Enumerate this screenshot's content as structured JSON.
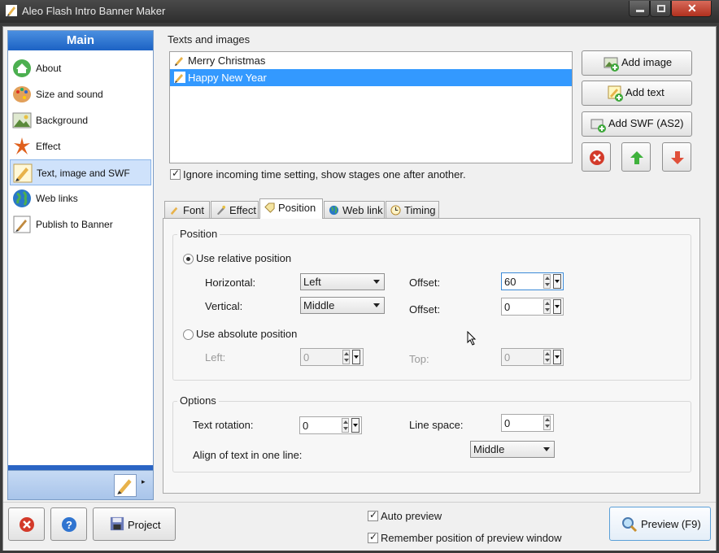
{
  "window": {
    "title": "Aleo Flash Intro Banner Maker"
  },
  "sidebar": {
    "header": "Main",
    "items": [
      {
        "label": "About",
        "icon": "home-icon"
      },
      {
        "label": "Size and sound",
        "icon": "palette-icon"
      },
      {
        "label": "Background",
        "icon": "picture-icon"
      },
      {
        "label": "Effect",
        "icon": "effect-icon"
      },
      {
        "label": "Text, image and SWF",
        "icon": "pencil-icon",
        "selected": true
      },
      {
        "label": "Web links",
        "icon": "globe-icon"
      },
      {
        "label": "Publish to Banner",
        "icon": "publish-icon"
      }
    ]
  },
  "texts": {
    "group_label": "Texts and images",
    "items": [
      {
        "label": "Merry Christmas"
      },
      {
        "label": "Happy New Year",
        "selected": true
      }
    ],
    "ignore_time_label": "Ignore incoming time setting, show stages one after another.",
    "ignore_time_checked": true
  },
  "buttons": {
    "add_image": "Add image",
    "add_text": "Add text",
    "add_swf": "Add SWF (AS2)"
  },
  "tabs": [
    {
      "label": "Font",
      "icon": "font-icon"
    },
    {
      "label": "Effect",
      "icon": "effect-icon"
    },
    {
      "label": "Position",
      "icon": "tag-icon",
      "selected": true
    },
    {
      "label": "Web link",
      "icon": "globe-icon"
    },
    {
      "label": "Timing",
      "icon": "clock-icon"
    }
  ],
  "position": {
    "group_title": "Position",
    "relative_label": "Use relative position",
    "relative_checked": true,
    "horizontal_label": "Horizontal:",
    "horizontal_value": "Left",
    "vertical_label": "Vertical:",
    "vertical_value": "Middle",
    "offset_label": "Offset:",
    "offset_h_value": "60",
    "offset_v_value": "0",
    "absolute_label": "Use absolute position",
    "left_label": "Left:",
    "left_value": "0",
    "top_label": "Top:",
    "top_value": "0"
  },
  "options": {
    "group_title": "Options",
    "rotation_label": "Text rotation:",
    "rotation_value": "0",
    "line_space_label": "Line space:",
    "line_space_value": "0",
    "align_label": "Align of text in one line:",
    "align_value": "Middle"
  },
  "bottom": {
    "project_label": "Project",
    "auto_preview_label": "Auto preview",
    "auto_preview_checked": true,
    "remember_label": "Remember position of preview window",
    "remember_checked": true,
    "preview_label": "Preview (F9)"
  },
  "colors": {
    "accent": "#3399ff",
    "sidebar_header": "#1c62c4",
    "delete_red": "#d33a2a",
    "up_green": "#3fb23c"
  }
}
